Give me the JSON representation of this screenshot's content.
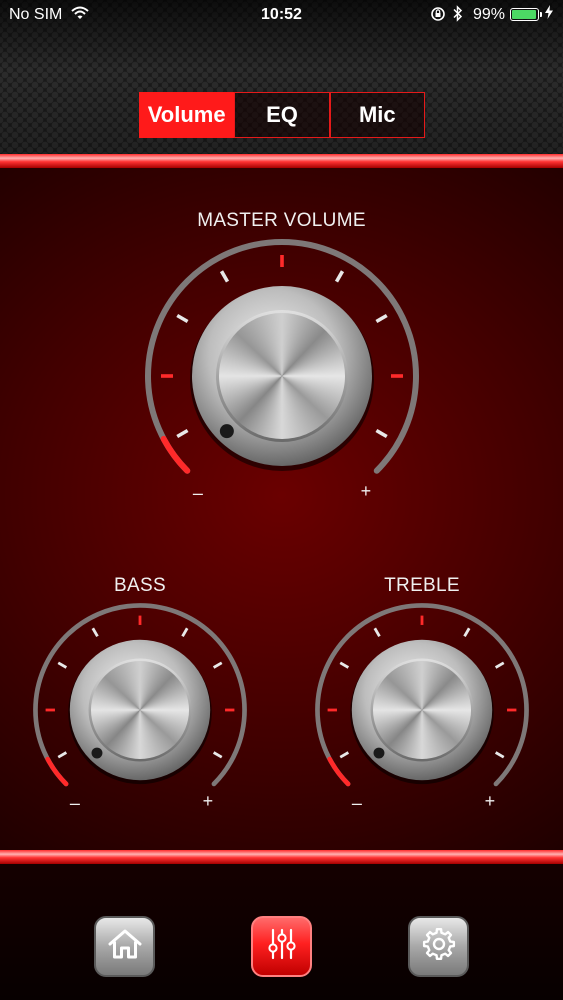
{
  "status_bar": {
    "carrier": "No SIM",
    "time": "10:52",
    "battery_percent": "99%",
    "battery_level": 0.99
  },
  "tabs": [
    {
      "label": "Volume",
      "active": true
    },
    {
      "label": "EQ",
      "active": false
    },
    {
      "label": "Mic",
      "active": false
    }
  ],
  "knobs": {
    "master": {
      "label": "MASTER VOLUME",
      "min_label": "–",
      "max_label": "+",
      "level": 0.0
    },
    "bass": {
      "label": "BASS",
      "min_label": "–",
      "max_label": "+",
      "level": 0.0
    },
    "treble": {
      "label": "TREBLE",
      "min_label": "–",
      "max_label": "+",
      "level": 0.0
    }
  },
  "nav": {
    "items": [
      {
        "name": "home",
        "icon": "home-icon",
        "active": false
      },
      {
        "name": "mixer",
        "icon": "sliders-icon",
        "active": true
      },
      {
        "name": "settings",
        "icon": "gear-icon",
        "active": false
      }
    ]
  },
  "colors": {
    "accent": "#ff1a1a",
    "background": "#420000",
    "tick_white": "#e8e8e8",
    "tick_red": "#ff2a2a"
  }
}
